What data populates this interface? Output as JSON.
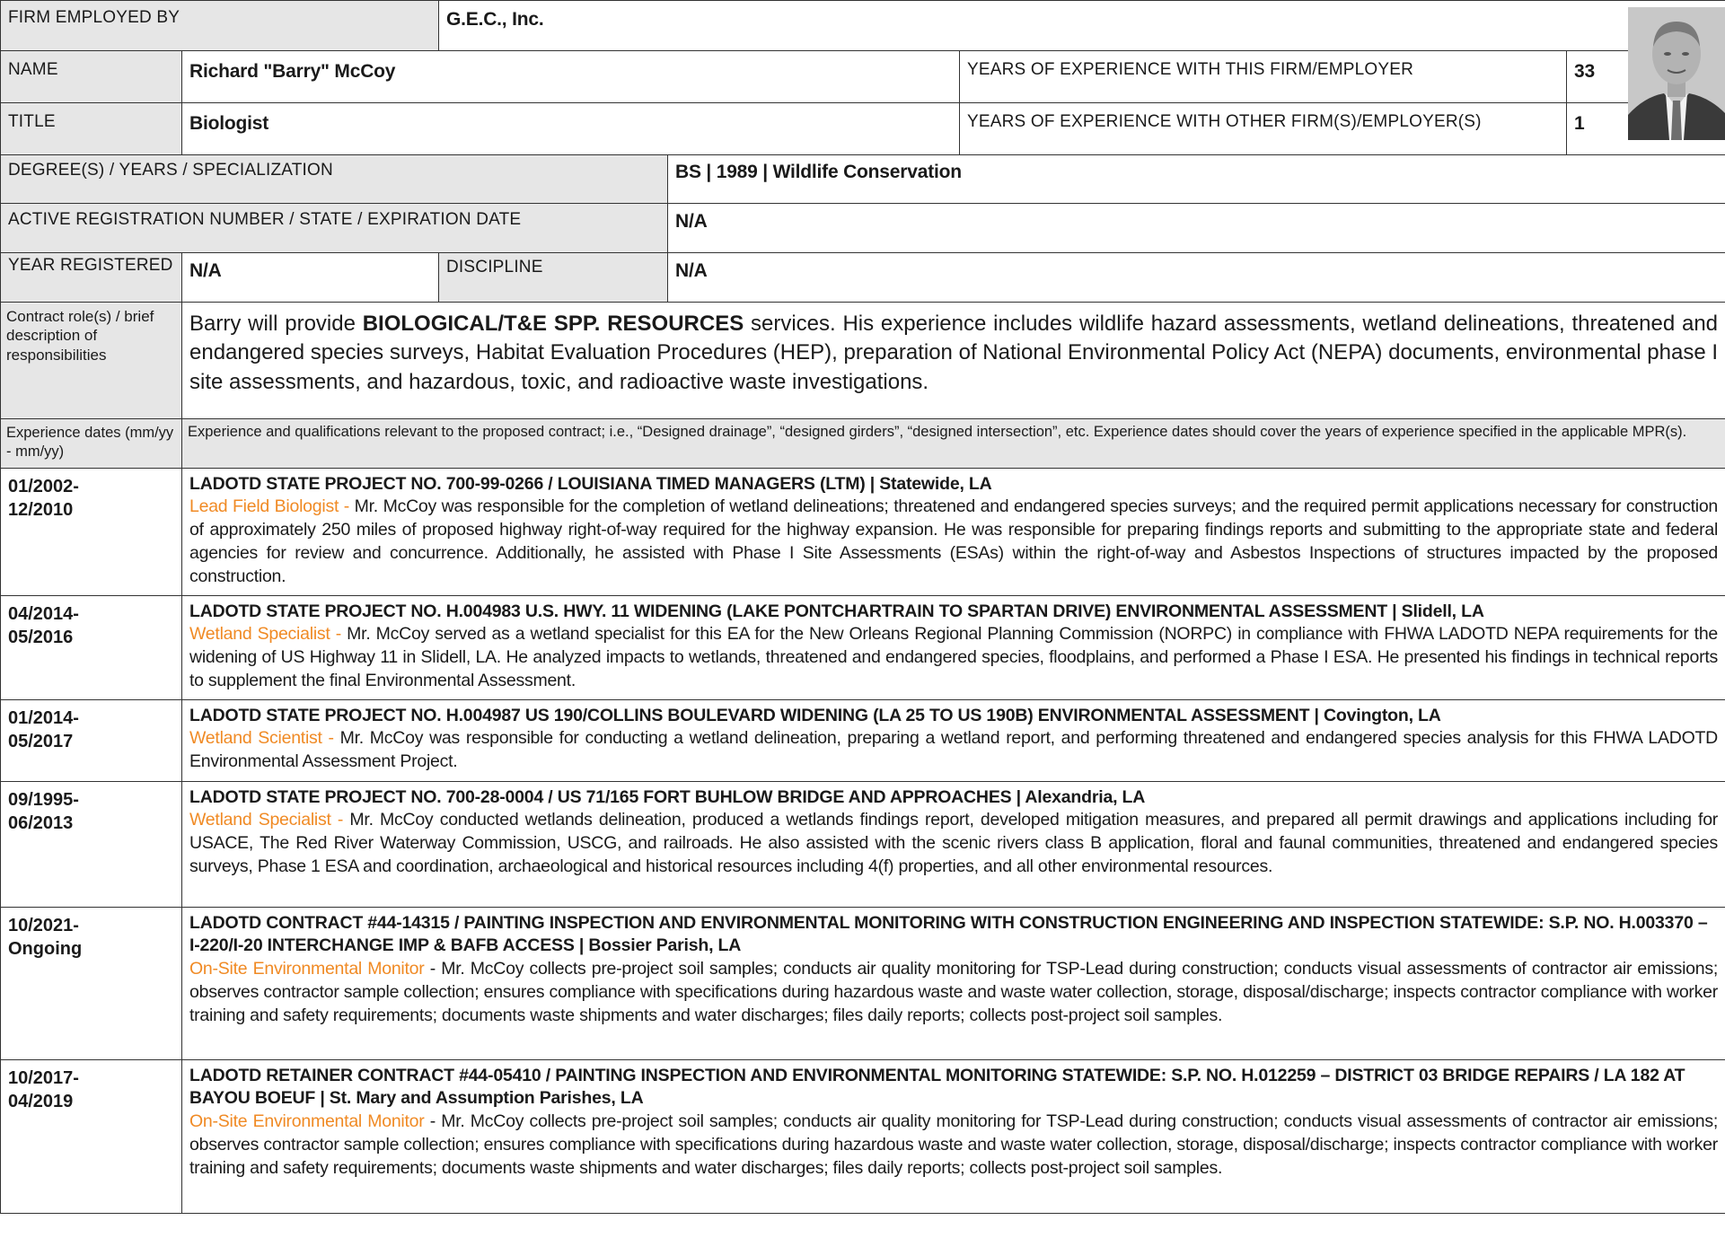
{
  "header": {
    "firm_label": "FIRM EMPLOYED BY",
    "firm_value": "G.E.C., Inc.",
    "name_label": "NAME",
    "name_value": "Richard \"Barry\" McCoy",
    "years_this_label": "YEARS OF EXPERIENCE WITH THIS FIRM/EMPLOYER",
    "years_this_value": "33",
    "title_label": "TITLE",
    "title_value": "Biologist",
    "years_other_label": "YEARS OF EXPERIENCE WITH OTHER FIRM(S)/EMPLOYER(S)",
    "years_other_value": "1",
    "degree_label": "DEGREE(S) / YEARS / SPECIALIZATION",
    "degree_value": "BS | 1989 | Wildlife Conservation",
    "registration_label": "ACTIVE REGISTRATION NUMBER / STATE / EXPIRATION DATE",
    "registration_value": "N/A",
    "year_registered_label": "YEAR REGISTERED",
    "year_registered_value": "N/A",
    "discipline_label": "DISCIPLINE",
    "discipline_value": "N/A"
  },
  "contract_role": {
    "label": "Contract role(s) / brief description of responsibilities",
    "intro": "Barry will provide ",
    "highlight": "BIOLOGICAL/T&E SPP. RESOURCES",
    "rest": " services. His experience includes wildlife hazard assessments, wetland delineations, threatened and endangered species surveys, Habitat Evaluation Procedures (HEP), preparation of National Environmental Policy Act (NEPA) documents, environmental phase I site assessments, and hazardous, toxic, and radioactive waste investigations."
  },
  "experience_header": {
    "label": "Experience dates (mm/yy - mm/yy)",
    "instructions": "Experience and qualifications relevant to the proposed contract; i.e., “Designed drainage”, “designed girders”, “designed intersection”, etc. Experience dates should cover the years of experience specified in the applicable MPR(s)."
  },
  "projects": [
    {
      "dates": "01/2002-\n12/2010",
      "title": "LADOTD STATE PROJECT NO. 700-99-0266 / LOUISIANA TIMED MANAGERS (LTM) | Statewide, LA",
      "role": "Lead Field Biologist - ",
      "description": "Mr. McCoy was responsible for the completion of wetland delineations; threatened and endangered species surveys; and the required permit applications necessary for construction of approximately 250 miles of proposed highway right-of-way required for the highway expansion. He was responsible for preparing findings reports and submitting to the appropriate state and federal agencies for review and concurrence. Additionally, he assisted with Phase I Site Assessments (ESAs) within the right-of-way and Asbestos Inspections of structures impacted by the proposed construction."
    },
    {
      "dates": "04/2014-\n05/2016",
      "title": "LADOTD STATE PROJECT NO. H.004983 U.S. HWY. 11 WIDENING (LAKE PONTCHARTRAIN TO SPARTAN DRIVE) ENVIRONMENTAL ASSESSMENT | Slidell, LA",
      "role": "Wetland Specialist - ",
      "description": "Mr. McCoy served as a wetland specialist for this EA for the New Orleans Regional Planning Commission (NORPC) in compliance with FHWA LADOTD NEPA requirements for the widening of US Highway 11 in Slidell, LA. He analyzed impacts to wetlands, threatened and endangered species, floodplains, and performed a Phase I ESA. He presented his findings in technical reports to supplement the final Environmental Assessment."
    },
    {
      "dates": "01/2014-\n05/2017",
      "title": "LADOTD STATE PROJECT NO. H.004987 US 190/COLLINS BOULEVARD WIDENING (LA 25 TO US 190B) ENVIRONMENTAL ASSESSMENT | Covington, LA",
      "role": "Wetland Scientist - ",
      "description": "Mr. McCoy was responsible for conducting a wetland delineation, preparing a wetland report, and performing threatened and endangered species analysis for this FHWA LADOTD Environmental Assessment Project."
    },
    {
      "dates": "09/1995-\n06/2013",
      "title": "LADOTD STATE PROJECT NO. 700-28-0004 / US 71/165 FORT BUHLOW BRIDGE AND APPROACHES | Alexandria, LA",
      "role": "Wetland Specialist - ",
      "description": "Mr. McCoy conducted wetlands delineation, produced a wetlands findings report, developed mitigation measures, and prepared all permit drawings and applications including for USACE, The Red River Waterway Commission, USCG, and railroads. He also assisted with the scenic rivers class B application, floral and faunal communities, threatened and endangered species surveys, Phase 1 ESA and coordination, archaeological and historical resources including 4(f) properties, and all other environmental resources."
    },
    {
      "dates": "10/2021-\nOngoing",
      "title": "LADOTD CONTRACT #44-14315 / PAINTING INSPECTION AND ENVIRONMENTAL MONITORING WITH CONSTRUCTION ENGINEERING AND INSPECTION STATEWIDE: S.P. NO. H.003370 – I-220/I-20 INTERCHANGE IMP & BAFB ACCESS | Bossier Parish, LA",
      "role": "On-Site Environmental Monitor",
      "description": " - Mr. McCoy collects pre-project soil samples; conducts air quality monitoring for TSP-Lead during construction; conducts visual assessments of contractor air emissions; observes contractor sample collection; ensures compliance with specifications during hazardous waste and waste water collection, storage, disposal/discharge; inspects  contractor compliance with worker training and safety requirements; documents waste shipments and water discharges; files daily reports; collects post-project soil samples."
    },
    {
      "dates": "10/2017-\n04/2019",
      "title": "LADOTD RETAINER CONTRACT #44-05410 / PAINTING INSPECTION AND ENVIRONMENTAL MONITORING STATEWIDE: S.P. NO. H.012259 – DISTRICT 03 BRIDGE REPAIRS / LA 182 AT BAYOU BOEUF | St. Mary and Assumption Parishes, LA",
      "role": "On-Site Environmental Monitor",
      "description": " - Mr. McCoy collects pre-project soil samples; conducts air quality monitoring for TSP-Lead during construction; conducts visual assessments of contractor air emissions; observes contractor sample collection; ensures compliance with specifications during hazardous waste and waste water collection, storage, disposal/discharge; inspects  contractor compliance with worker training and safety requirements; documents waste shipments and water discharges; files daily reports; collects post-project soil samples."
    }
  ],
  "colors": {
    "label_bg": "#e6e6e6",
    "role_accent": "#f08a24",
    "border": "#333333"
  }
}
